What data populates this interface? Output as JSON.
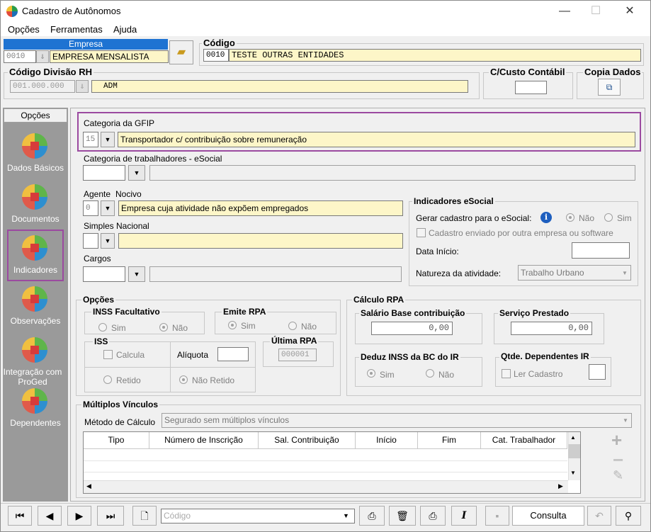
{
  "window": {
    "title": "Cadastro de Autônomos",
    "minimize": "—",
    "maximize": "☐",
    "close": "✕"
  },
  "menu": [
    "Opções",
    "Ferramentas",
    "Ajuda"
  ],
  "empresa": {
    "header": "Empresa",
    "code": "0010",
    "name": "EMPRESA MENSALISTA"
  },
  "codigo": {
    "label": "Código",
    "code": "0010",
    "name": "TESTE OUTRAS ENTIDADES"
  },
  "divisao": {
    "label": "Código Divisão RH",
    "code": "001.000.000",
    "name": "ADM"
  },
  "custo": {
    "label": "C/Custo Contábil"
  },
  "copia": {
    "label": "Copia Dados"
  },
  "sidebar": {
    "header": "Opções",
    "items": [
      {
        "label": "Dados Básicos"
      },
      {
        "label": "Documentos"
      },
      {
        "label": "Indicadores"
      },
      {
        "label": "Observações"
      },
      {
        "label": "Integração com ProGed"
      },
      {
        "label": "Dependentes"
      }
    ]
  },
  "gfip": {
    "label": "Categoria da GFIP",
    "code": "15",
    "value": "Transportador c/ contribuição sobre remuneração"
  },
  "esocial_cat": {
    "label": "Categoria de trabalhadores - eSocial"
  },
  "agente": {
    "label": "Agente",
    "label2": "Nocivo",
    "code": "0",
    "value": "Empresa cuja atividade não expõem empregados"
  },
  "simples": {
    "label": "Simples Nacional"
  },
  "cargos": {
    "label": "Cargos"
  },
  "indicadores": {
    "title": "Indicadores eSocial",
    "gerar_label": "Gerar cadastro para o eSocial:",
    "nao": "Não",
    "sim": "Sim",
    "enviado": "Cadastro enviado por outra empresa ou software",
    "data_inicio": "Data Início:",
    "natureza_label": "Natureza da atividade:",
    "natureza_value": "Trabalho Urbano"
  },
  "opcoes": {
    "title": "Opções",
    "inss": {
      "title": "INSS Facultativo",
      "sim": "Sim",
      "nao": "Não"
    },
    "rpa": {
      "title": "Emite RPA",
      "sim": "Sim",
      "nao": "Não"
    },
    "iss": {
      "title": "ISS",
      "calcula": "Calcula",
      "aliquota": "Alíquota",
      "retido": "Retido",
      "nao_retido": "Não Retido"
    },
    "ultima": {
      "title": "Última RPA",
      "value": "000001"
    }
  },
  "calculo": {
    "title": "Cálculo RPA",
    "salario": {
      "title": "Salário Base contribuição",
      "value": "0,00"
    },
    "servico": {
      "title": "Serviço Prestado",
      "value": "0,00"
    },
    "deduz": {
      "title": "Deduz INSS da BC do IR",
      "sim": "Sim",
      "nao": "Não"
    },
    "dependentes": {
      "title": "Qtde. Dependentes IR",
      "ler": "Ler Cadastro"
    }
  },
  "multiplos": {
    "title": "Múltiplos Vínculos",
    "metodo_label": "Método de Cálculo",
    "metodo_value": "Segurado sem múltiplos vínculos",
    "columns": [
      "Tipo",
      "Número de Inscrição",
      "Sal. Contribuição",
      "Início",
      "Fim",
      "Cat. Trabalhador"
    ]
  },
  "toolbar": {
    "codigo_placeholder": "Código",
    "consulta": "Consulta"
  }
}
